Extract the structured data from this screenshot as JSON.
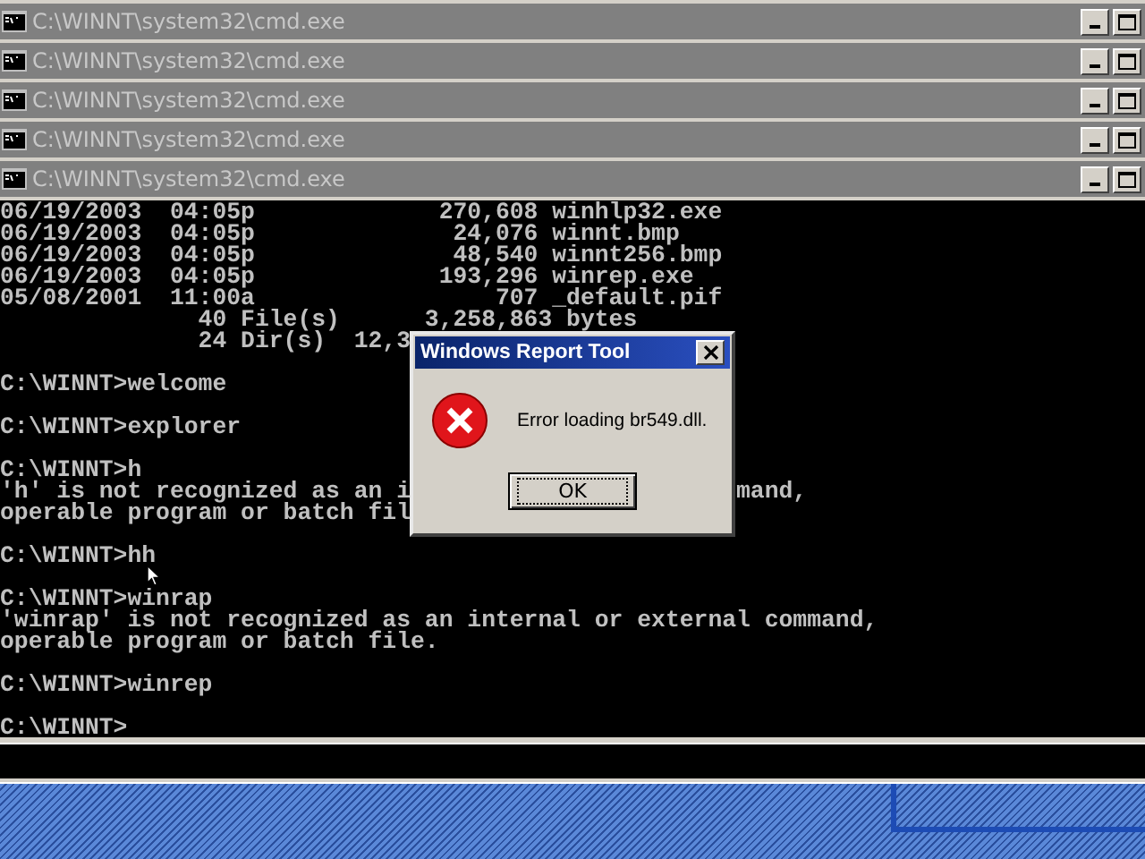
{
  "windows": [
    {
      "title": "C:\\WINNT\\system32\\cmd.exe"
    },
    {
      "title": "C:\\WINNT\\system32\\cmd.exe"
    },
    {
      "title": "C:\\WINNT\\system32\\cmd.exe"
    },
    {
      "title": "C:\\WINNT\\system32\\cmd.exe"
    },
    {
      "title": "C:\\WINNT\\system32\\cmd.exe"
    }
  ],
  "console": {
    "blocks": [
      [
        "06/19/2003  04:05p             270,608 winhlp32.exe",
        "06/19/2003  04:05p              24,076 winnt.bmp",
        "06/19/2003  04:05p              48,540 winnt256.bmp",
        "06/19/2003  04:05p             193,296 winrep.exe",
        "05/08/2001  11:00a                 707 _default.pif",
        "              40 File(s)      3,258,863 bytes",
        "              24 Dir(s)  12,3"
      ],
      [
        "C:\\WINNT>welcome"
      ],
      [
        "C:\\WINNT>explorer"
      ],
      [
        "C:\\WINNT>h",
        [
          "'h' is not recognized as an i",
          "mand,"
        ],
        "operable program or batch fil"
      ],
      [
        "C:\\WINNT>hh"
      ],
      [
        "C:\\WINNT>winrap",
        "'winrap' is not recognized as an internal or external command,",
        "operable program or batch file."
      ],
      [
        "C:\\WINNT>winrep"
      ],
      [
        "C:\\WINNT>"
      ]
    ]
  },
  "dialog": {
    "title": "Windows Report Tool",
    "message": "Error loading br549.dll.",
    "buttons": [
      "OK"
    ]
  }
}
